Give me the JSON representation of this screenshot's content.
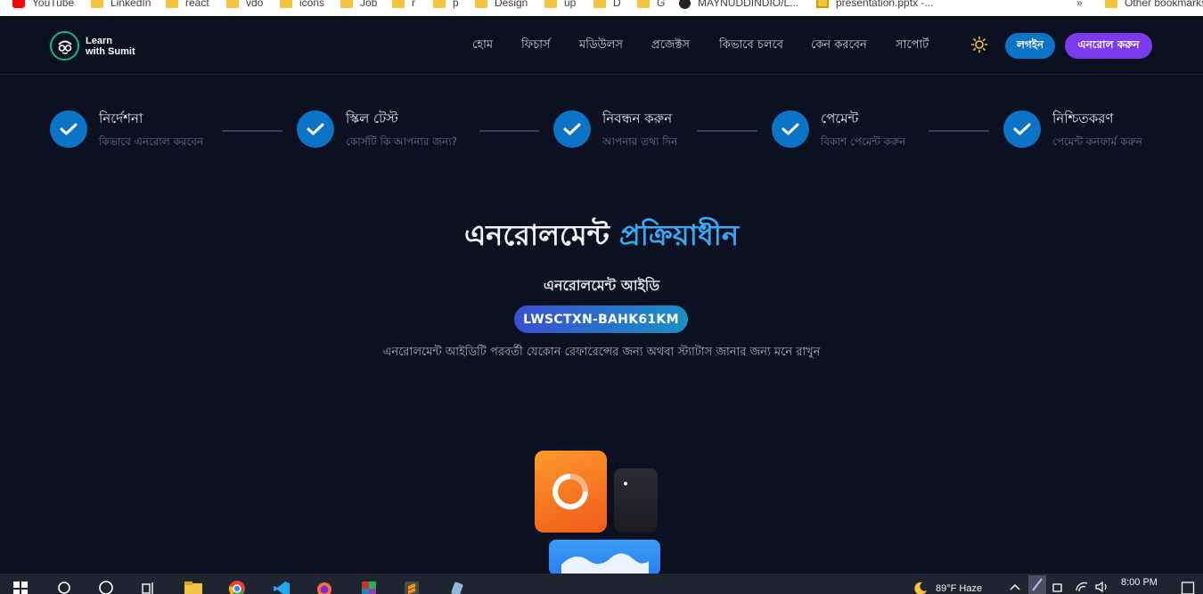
{
  "bookmarks": [
    {
      "label": "YouTube",
      "icon": "youtube-icon"
    },
    {
      "label": "LinkedIn",
      "icon": "folder-icon"
    },
    {
      "label": "react",
      "icon": "folder-icon"
    },
    {
      "label": "vdo",
      "icon": "folder-icon"
    },
    {
      "label": "icons",
      "icon": "folder-icon"
    },
    {
      "label": "Job",
      "icon": "folder-icon"
    },
    {
      "label": "r",
      "icon": "folder-icon"
    },
    {
      "label": "p",
      "icon": "folder-icon"
    },
    {
      "label": "Design",
      "icon": "folder-icon"
    },
    {
      "label": "up",
      "icon": "folder-icon"
    },
    {
      "label": "D",
      "icon": "folder-icon"
    },
    {
      "label": "G",
      "icon": "folder-icon"
    },
    {
      "label": "MAYNUDDINDIO/L...",
      "icon": "github-icon"
    },
    {
      "label": "presentation.pptx -...",
      "icon": "slides-icon"
    },
    {
      "label": "»",
      "icon": ""
    },
    {
      "label": "Other bookmarks",
      "icon": "folder-icon"
    }
  ],
  "brand": {
    "line1": "Learn",
    "line2": "with Sumit"
  },
  "nav": {
    "links": [
      "হোম",
      "ফিচার্স",
      "মডিউলস",
      "প্রজেক্টস",
      "কিভাবে চলবে",
      "কেন করবেন",
      "সাপোর্ট"
    ],
    "login": "লগইন",
    "enroll": "এনরোল করুন"
  },
  "steps": [
    {
      "title": "নির্দেশনা",
      "subtitle": "কিভাবে এনরোল করবেন"
    },
    {
      "title": "স্কিল টেস্ট",
      "subtitle": "কোর্সটি কি আপনার জন্য?"
    },
    {
      "title": "নিবন্ধন করুন",
      "subtitle": "আপনার তথ্য দিন"
    },
    {
      "title": "পেমেন্ট",
      "subtitle": "বিকাশ পেমেন্ট করুন"
    },
    {
      "title": "নিশ্চিতকরণ",
      "subtitle": "পেমেন্ট কনফার্ম করুন"
    }
  ],
  "main": {
    "heading_part1": "এনরোলমেন্ট",
    "heading_part2": "প্রক্রিয়াধীন",
    "id_label": "এনরোলমেন্ট আইডি",
    "id_value": "LWSCTXN-BAHK61KM",
    "note": "এনরোলমেন্ট আইডিটি পরবর্তী যেকোন রেফারেন্সের জন্য অথবা স্ট্যাটাস জানার জন্য মনে রাখুন"
  },
  "taskbar": {
    "weather": "89°F  Haze",
    "time": "8:00 PM"
  },
  "colors": {
    "background": "#0b1120",
    "accent_blue": "#0c74c6",
    "accent_purple": "#7c3aed",
    "heading_accent": "#38a8f5"
  }
}
